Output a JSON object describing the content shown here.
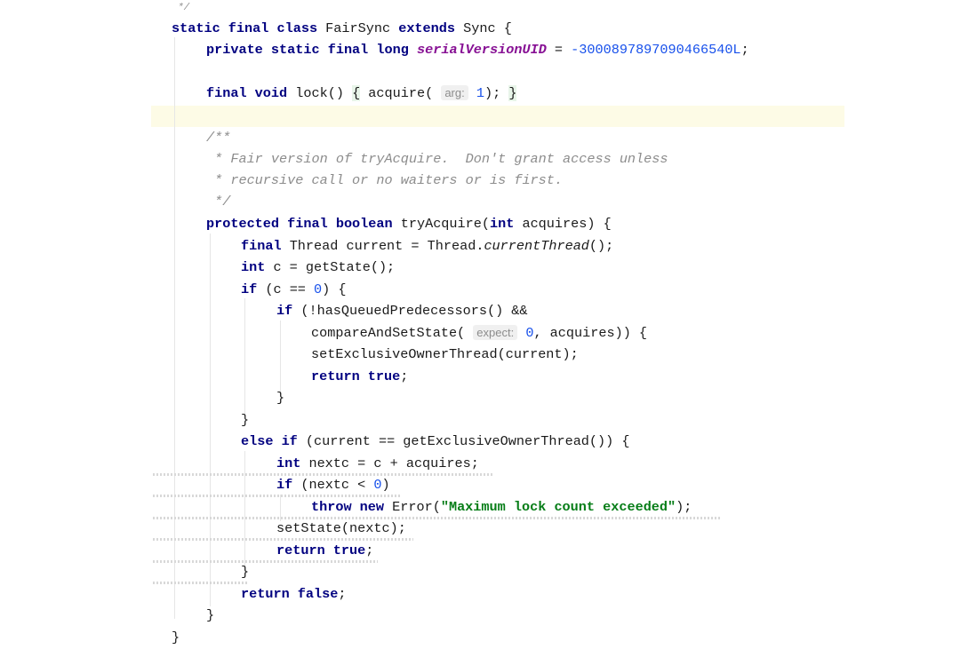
{
  "editor": {
    "lines": {
      "l0": "*/",
      "l1": {
        "kw1": "static final class",
        "name": " FairSync ",
        "kw2": "extends",
        "rest": " Sync {"
      },
      "l2": {
        "kw": "private static final long",
        "field": "serialVersionUID",
        "eq": " = ",
        "value": "-3000897897090466540L",
        "end": ";"
      },
      "l3": {
        "kw": "final void",
        "sig": " lock() ",
        "open": "{",
        "call": " acquire( ",
        "hint": "arg:",
        "arg": "1",
        "close_call": "); ",
        "close": "}"
      },
      "c1": "/**",
      "c2": " * Fair version of tryAcquire.  Don't grant access unless",
      "c3": " * recursive call or no waiters or is first.",
      "c4": " */",
      "m1": {
        "kw": "protected final boolean",
        "name": " tryAcquire(",
        "kw2": "int",
        "rest": " acquires) {"
      },
      "m2": {
        "kw": "final",
        "a": " Thread current = Thread.",
        "b": "currentThread",
        "c": "();"
      },
      "m3": {
        "kw": "int",
        "rest": " c = getState();"
      },
      "m4": {
        "kw": "if",
        "a": " (c == ",
        "num": "0",
        "b": ") {"
      },
      "m5": {
        "kw": "if",
        "rest": " (!hasQueuedPredecessors() &&"
      },
      "m6": {
        "a": "compareAndSetState( ",
        "hint": "expect:",
        "num": "0",
        "b": ", acquires)) {"
      },
      "m7": "setExclusiveOwnerThread(current);",
      "m8": {
        "kw": "return true",
        "end": ";"
      },
      "m9": "}",
      "m10": "}",
      "m11": {
        "kw": "else if",
        "rest": " (current == getExclusiveOwnerThread()) {"
      },
      "m12": {
        "kw": "int",
        "rest": " nextc = c + acquires;"
      },
      "m13": {
        "kw": "if",
        "a": " (nextc < ",
        "num": "0",
        "b": ")"
      },
      "m14": {
        "kw": "throw new",
        "a": " Error(",
        "str": "\"Maximum lock count exceeded\"",
        "b": ");"
      },
      "m15": "setState(nextc);",
      "m16": {
        "kw": "return true",
        "end": ";"
      },
      "m17": "}",
      "m18": {
        "kw": "return false",
        "end": ";"
      },
      "m19": "}",
      "m20": "}"
    }
  }
}
